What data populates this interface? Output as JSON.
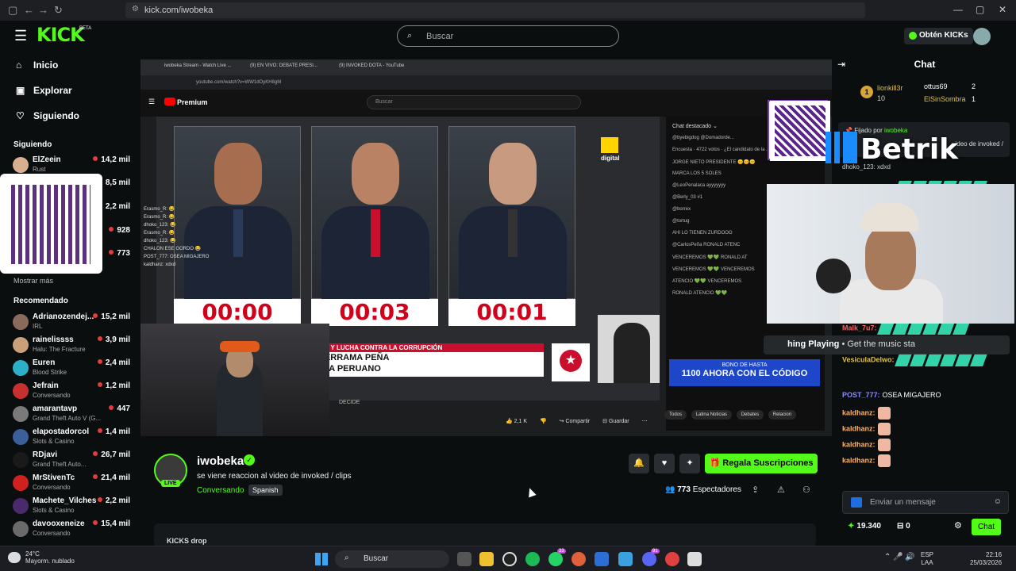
{
  "browser": {
    "url": "kick.com/iwobeka",
    "nav_back": "←",
    "nav_forward": "→",
    "nav_reload": "↻"
  },
  "header": {
    "logo": "KICK",
    "logo_badge": "BETA",
    "search_placeholder": "Buscar",
    "get_kicks_label": "Obtén KICKs"
  },
  "sidebar": {
    "nav": [
      {
        "label": "Inicio",
        "icon": "home-icon"
      },
      {
        "label": "Explorar",
        "icon": "compass-icon"
      },
      {
        "label": "Siguiendo",
        "icon": "heart-icon"
      }
    ],
    "following_title": "Siguiendo",
    "following": [
      {
        "name": "ElZeein",
        "category": "Rust",
        "viewers": "14,2 mil"
      },
      {
        "name": "",
        "category": "",
        "viewers": "8,5 mil"
      },
      {
        "name": "",
        "category": "",
        "viewers": "2,2 mil"
      },
      {
        "name": "",
        "category": "",
        "viewers": "928"
      },
      {
        "name": "",
        "category": "",
        "viewers": "773"
      }
    ],
    "show_more": "Mostrar más",
    "recommended_title": "Recomendado",
    "recommended": [
      {
        "name": "Adrianozendej...",
        "category": "IRL",
        "viewers": "15,2 mil",
        "color": "#8a6a5a"
      },
      {
        "name": "rainelissss",
        "category": "Halu: The Fracture",
        "viewers": "3,9 mil",
        "color": "#c9a07a"
      },
      {
        "name": "Euren",
        "category": "Blood Strike",
        "viewers": "2,4 mil",
        "color": "#2ab0c8"
      },
      {
        "name": "Jefrain",
        "category": "Conversando",
        "viewers": "1,2 mil",
        "color": "#c83030"
      },
      {
        "name": "amarantavp",
        "category": "Grand Theft Auto V (G...",
        "viewers": "447",
        "color": "#7a7a7a"
      },
      {
        "name": "elapostadorcol",
        "category": "Slots & Casino",
        "viewers": "1,4 mil",
        "color": "#3a5f9a"
      },
      {
        "name": "RDjavi",
        "category": "Grand Theft Auto...",
        "viewers": "26,7 mil",
        "color": "#1a1a1a"
      },
      {
        "name": "MrStivenTc",
        "category": "Conversando",
        "viewers": "21,4 mil",
        "color": "#d02020"
      },
      {
        "name": "Machete_Vilches",
        "category": "Slots & Casino",
        "viewers": "2,2 mil",
        "color": "#4a2a6a"
      },
      {
        "name": "davooxeneize",
        "category": "Conversando",
        "viewers": "15,4 mil",
        "color": "#6a6a6a"
      }
    ]
  },
  "video": {
    "yt_tabs": [
      "iwobeka Stream - Watch Live ...",
      "(9) EN VIVO: DEBATE PRESI...",
      "(9) INVOKED DOTA - YouTube"
    ],
    "yt_url": "youtube.com/watch?v=WW1dOyKH8gM",
    "yt_logo": "Premium",
    "yt_search": "Buscar",
    "timers": [
      "00:00",
      "00:03",
      "00:01"
    ],
    "lower_third_strip": "ICA Y LUCHA CONTRA LA CORRUPCIÓN",
    "lower_third_lines": [
      "DERRAMA PEÑA",
      "STA PERUANO"
    ],
    "digital_label": "digital",
    "yt_chat_title": "Chat destacado ⌄",
    "yt_chat_lines": [
      "@byebigdog   @Domadorde...",
      "Encuesta · 4722 votos · ¿El candidato de la ...",
      "JORGE NIETO PRESIDENTE 😊😊😊",
      "MARCA LOS 5 SOLES",
      "@LeoPenalaca ayyyyyyy",
      "@Berly_03 #1",
      "@borrex",
      "@tortug",
      "AHI LO TIENEN ZURDOOO",
      "@CarlosPeña  RONALD ATENC",
      "VENCEREMOS 💚💚 RONALD AT",
      "VENCEREMOS 💚💚 VENCEREMOS",
      "ATENCIO 💚💚 VENCEREMOS",
      "RONALD ATENCIO 💚💚"
    ],
    "bono_line1": "BONO DE HASTA",
    "bono_line2": "1100 AHORA CON EL CÓDIGO",
    "feed_chat": [
      "Erasmo_R: 😂",
      "Erasmo_R: 😂",
      "dhoko_123: 😂",
      "Erasmo_R: 😂",
      "dhoko_123: 😂",
      "CHALON ESE GORDO 😂",
      "POST_777: OSEA MIGAJERO",
      "kaldhanz: xdxd"
    ],
    "yt_actions": [
      "👍 2,1 K",
      "👎",
      "↪ Compartir",
      "⊟ Guardar",
      "⋯"
    ],
    "yt_chips": [
      "Todos",
      "Latina Noticias",
      "Debates",
      "Relacion"
    ],
    "yt_meta": "DECIDE"
  },
  "channel": {
    "name": "iwobeka",
    "live_label": "LIVE",
    "title": "se viene reaccion al video de invoked / clips",
    "category": "Conversando",
    "language": "Spanish",
    "viewers": "773",
    "viewers_label": "Espectadores",
    "subscribe_label": "Regala Suscripciones",
    "kicks_drop": "KICKS drop"
  },
  "chat": {
    "title": "Chat",
    "leaderboard": [
      {
        "rank": "1",
        "name": "lionkill3r",
        "count": "10"
      },
      {
        "rank": "",
        "name": "ottus69",
        "count": "2"
      },
      {
        "rank": "",
        "name": "ElSinSombra",
        "count": "1"
      }
    ],
    "pinned_by_label": "Fijado por",
    "pinned_by_user": "iwobeka",
    "pinned_text": "ideo de invoked /",
    "pinned_user_line": "dhoko_123: xdxd",
    "betrik": "Betrik",
    "music": {
      "bold": "hing Playing",
      "rest": "• Get the music sta"
    },
    "messages": [
      {
        "user": "VesiculaDelwo:",
        "text": "",
        "color": "#e0c040"
      },
      {
        "user": "Malk_7u7:",
        "text": "",
        "color": "#ff5a5a"
      },
      {
        "user": "VesiculaDelwo:",
        "text": "",
        "color": "#e0c040"
      },
      {
        "user": "POST_777:",
        "text": "OSEA MIGAJERO",
        "color": "#8a8aff"
      },
      {
        "user": "kaldhanz:",
        "text": "",
        "color": "#ffb060"
      },
      {
        "user": "kaldhanz:",
        "text": "",
        "color": "#ffb060"
      },
      {
        "user": "kaldhanz:",
        "text": "",
        "color": "#ffb060"
      },
      {
        "user": "kaldhanz:",
        "text": "",
        "color": "#ffb060"
      }
    ],
    "input_placeholder": "Enviar un mensaje",
    "kicks_balance": "19.340",
    "subs": "0",
    "send_label": "Chat"
  },
  "taskbar": {
    "temp": "24°C",
    "weather": "Mayorm. nublado",
    "search": "Buscar",
    "badge_whatsapp": "33",
    "badge_discord": "91",
    "lang_top": "ESP",
    "lang_bottom": "LAA",
    "time": "22:16",
    "date": "25/03/2026"
  }
}
